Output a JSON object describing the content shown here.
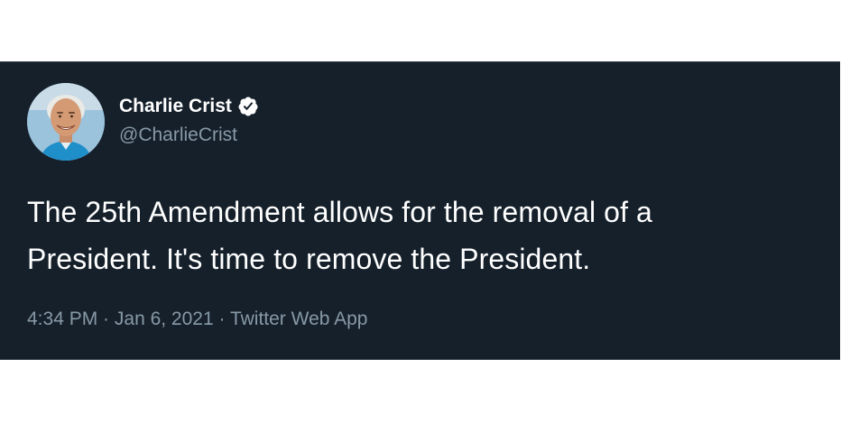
{
  "tweet": {
    "author": {
      "name": "Charlie Crist",
      "handle": "@CharlieCrist",
      "verified": true
    },
    "text_line_1": "The 25th Amendment allows for the removal of a",
    "text_line_2": "President. It's time to remove the President.",
    "time": "4:34 PM",
    "separator": " · ",
    "date": "Jan 6, 2021",
    "source": "Twitter Web App"
  },
  "colors": {
    "background": "#15202b",
    "text": "#ffffff",
    "secondary_text": "#8899a6",
    "verified_badge": "#ffffff"
  },
  "icons": {
    "verified": "verified-badge-icon",
    "avatar": "profile-photo"
  }
}
